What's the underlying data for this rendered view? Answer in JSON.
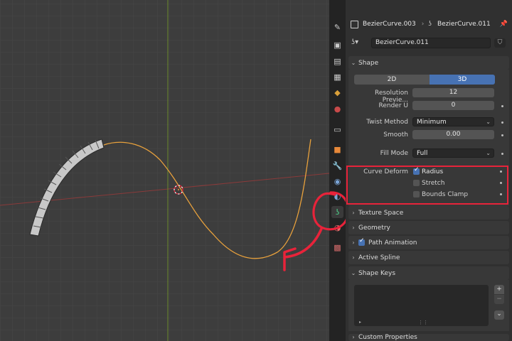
{
  "header": {
    "breadcrumb_object": "BezierCurve.003",
    "breadcrumb_sep": "›",
    "breadcrumb_data": "BezierCurve.011",
    "datablock_name": "BezierCurve.011"
  },
  "shape_panel": {
    "title": "Shape",
    "mode_2d": "2D",
    "mode_3d": "3D",
    "resolution_label": "Resolution Previe...",
    "resolution_value": "12",
    "render_u_label": "Render U",
    "render_u_value": "0",
    "twist_method_label": "Twist Method",
    "twist_method_value": "Minimum",
    "smooth_label": "Smooth",
    "smooth_value": "0.00",
    "fill_mode_label": "Fill Mode",
    "fill_mode_value": "Full",
    "curve_deform_label": "Curve Deform",
    "radius_label": "Radius",
    "radius_checked": true,
    "stretch_label": "Stretch",
    "stretch_checked": false,
    "bounds_clamp_label": "Bounds Clamp",
    "bounds_clamp_checked": false
  },
  "panels": {
    "texture_space": "Texture Space",
    "geometry": "Geometry",
    "path_animation": "Path Animation",
    "active_spline": "Active Spline",
    "shape_keys": "Shape Keys",
    "custom_properties": "Custom Properties"
  },
  "colors": {
    "accent": "#4772b3",
    "highlight": "#e8233a",
    "curve": "#e8a13c"
  }
}
